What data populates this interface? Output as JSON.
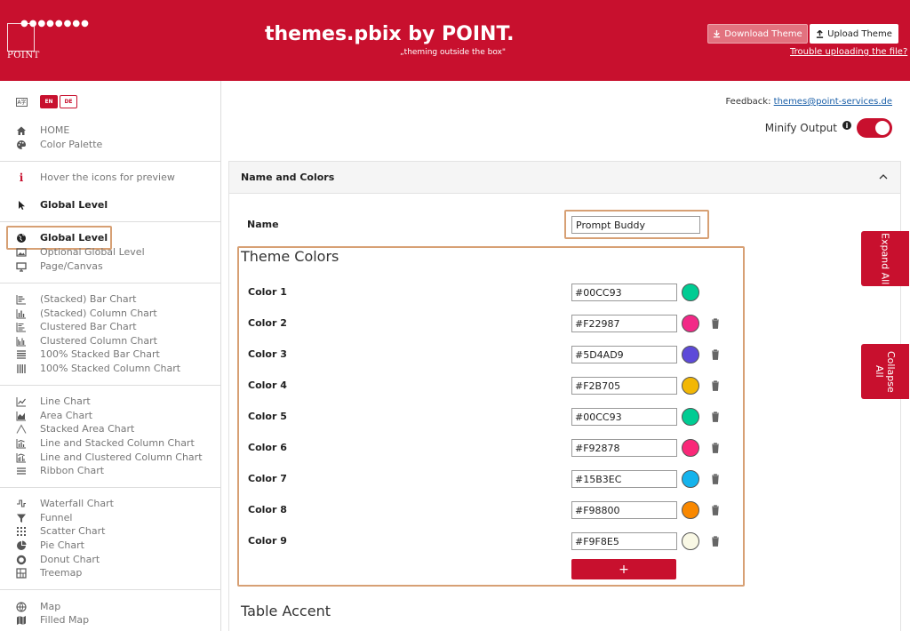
{
  "header": {
    "logo_dots": "●●●●●●●●",
    "logo_text": "POINT",
    "title": "themes.pbix by POINT.",
    "subtitle": "„theming outside the box\"",
    "download_label": "Download Theme",
    "upload_label": "Upload Theme",
    "trouble_link": "Trouble uploading the file?"
  },
  "sidebar": {
    "lang_icon": "A字",
    "lang_en": "EN",
    "lang_de": "DE",
    "items": [
      {
        "label": "HOME",
        "icon": "home-icon"
      },
      {
        "label": "Color Palette",
        "icon": "palette-icon"
      },
      {
        "label": "Hover the icons for preview",
        "icon": "info-icon"
      },
      {
        "label": "Global Level",
        "icon": "cursor-icon"
      },
      {
        "label": "Global Level",
        "icon": "globe-icon"
      },
      {
        "label": "Optional Global Level",
        "icon": "image-icon"
      },
      {
        "label": "Page/Canvas",
        "icon": "monitor-icon"
      },
      {
        "label": "(Stacked) Bar Chart",
        "icon": "bar-chart-icon"
      },
      {
        "label": "(Stacked) Column Chart",
        "icon": "column-chart-icon"
      },
      {
        "label": "Clustered Bar Chart",
        "icon": "clustered-bar-icon"
      },
      {
        "label": "Clustered Column Chart",
        "icon": "clustered-column-icon"
      },
      {
        "label": "100% Stacked Bar Chart",
        "icon": "stacked-bar-100-icon"
      },
      {
        "label": "100% Stacked Column Chart",
        "icon": "stacked-column-100-icon"
      },
      {
        "label": "Line Chart",
        "icon": "line-chart-icon"
      },
      {
        "label": "Area Chart",
        "icon": "area-chart-icon"
      },
      {
        "label": "Stacked Area Chart",
        "icon": "stacked-area-icon"
      },
      {
        "label": "Line and Stacked Column Chart",
        "icon": "line-stacked-column-icon"
      },
      {
        "label": "Line and Clustered Column Chart",
        "icon": "line-clustered-column-icon"
      },
      {
        "label": "Ribbon Chart",
        "icon": "ribbon-chart-icon"
      },
      {
        "label": "Waterfall Chart",
        "icon": "waterfall-icon"
      },
      {
        "label": "Funnel",
        "icon": "funnel-icon"
      },
      {
        "label": "Scatter Chart",
        "icon": "scatter-icon"
      },
      {
        "label": "Pie Chart",
        "icon": "pie-icon"
      },
      {
        "label": "Donut Chart",
        "icon": "donut-icon"
      },
      {
        "label": "Treemap",
        "icon": "treemap-icon"
      },
      {
        "label": "Map",
        "icon": "map-globe-icon"
      },
      {
        "label": "Filled Map",
        "icon": "filled-map-icon"
      }
    ]
  },
  "main": {
    "feedback_label": "Feedback:",
    "feedback_email": "themes@point-services.de",
    "minify_label": "Minify Output",
    "panel_title": "Name and Colors",
    "name_label": "Name",
    "name_value": "Prompt Buddy",
    "theme_colors_title": "Theme Colors",
    "table_accent_title": "Table Accent",
    "add_label": "+",
    "colors": [
      {
        "label": "Color 1",
        "value": "#00CC93",
        "hex": "#00CC93",
        "deletable": false
      },
      {
        "label": "Color 2",
        "value": "#F22987",
        "hex": "#F22987",
        "deletable": true
      },
      {
        "label": "Color 3",
        "value": "#5D4AD9",
        "hex": "#5D4AD9",
        "deletable": true
      },
      {
        "label": "Color 4",
        "value": "#F2B705",
        "hex": "#F2B705",
        "deletable": true
      },
      {
        "label": "Color 5",
        "value": "#00CC93",
        "hex": "#00CC93",
        "deletable": true
      },
      {
        "label": "Color 6",
        "value": "#F92878",
        "hex": "#F92878",
        "deletable": true
      },
      {
        "label": "Color 7",
        "value": "#15B3EC",
        "hex": "#15B3EC",
        "deletable": true
      },
      {
        "label": "Color 8",
        "value": "#F98800",
        "hex": "#F98800",
        "deletable": true
      },
      {
        "label": "Color 9",
        "value": "#F9F8E5",
        "hex": "#F9F8E5",
        "deletable": true
      }
    ]
  },
  "side_tabs": {
    "expand": "Expand All",
    "collapse": "Collapse All"
  },
  "theme": {
    "accent": "#C8102E",
    "highlight": "#D7A074"
  }
}
